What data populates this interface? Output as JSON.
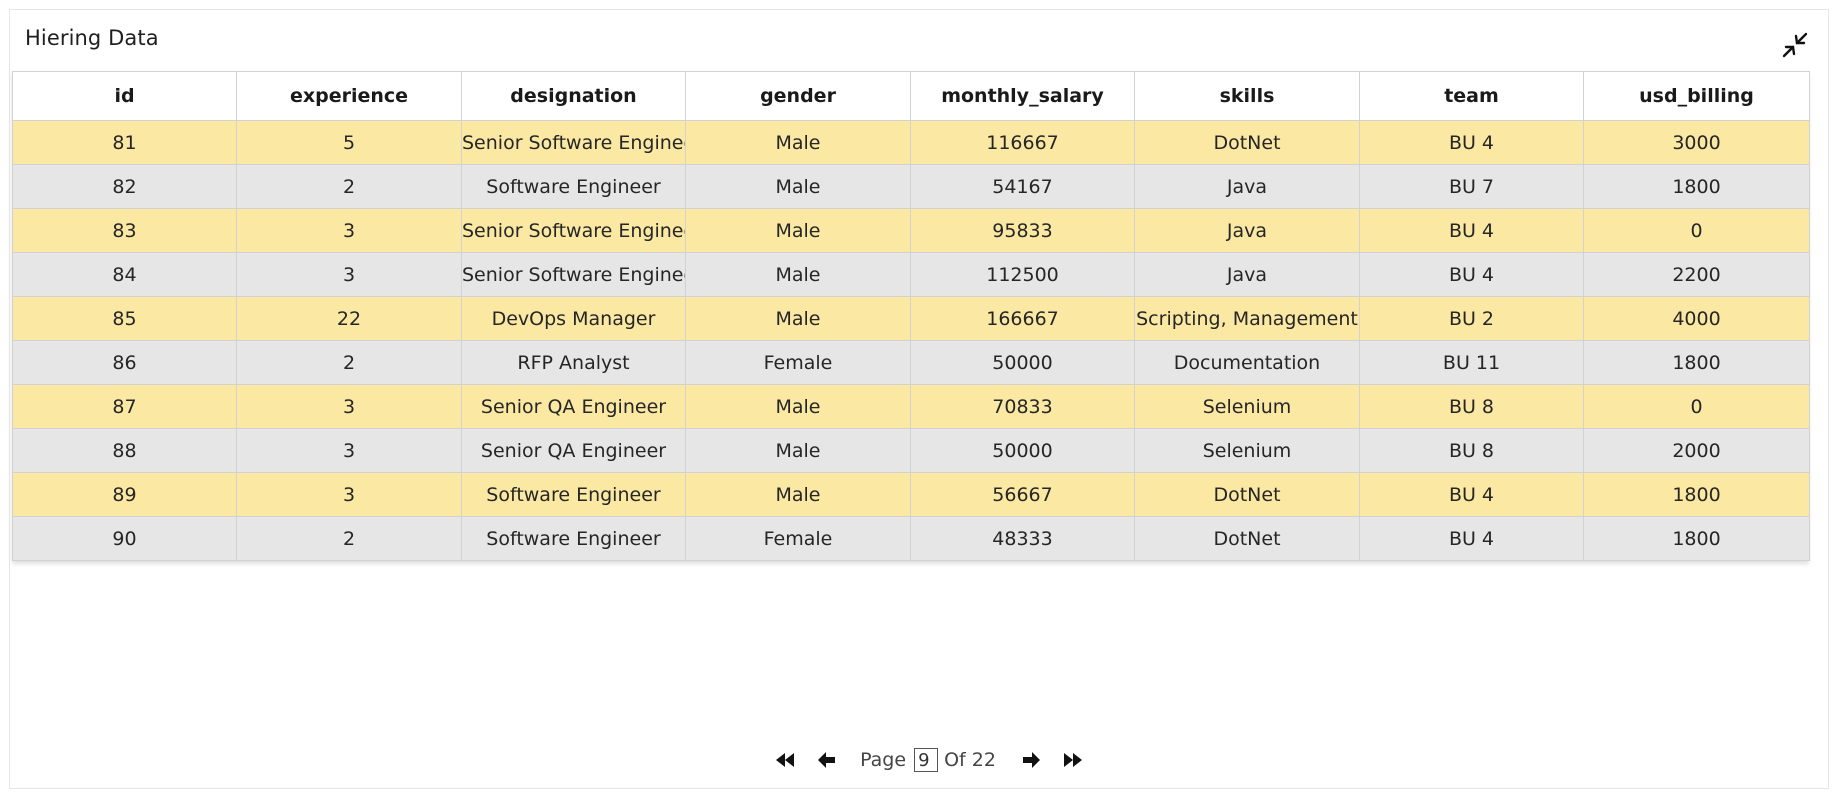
{
  "panel": {
    "title": "Hiering Data",
    "collapse_icon": "collapse-arrows-icon"
  },
  "table": {
    "columns": [
      "id",
      "experience",
      "designation",
      "gender",
      "monthly_salary",
      "skills",
      "team",
      "usd_billing"
    ],
    "rows": [
      [
        "81",
        "5",
        "Senior Software Engineer",
        "Male",
        "116667",
        "DotNet",
        "BU 4",
        "3000"
      ],
      [
        "82",
        "2",
        "Software Engineer",
        "Male",
        "54167",
        "Java",
        "BU 7",
        "1800"
      ],
      [
        "83",
        "3",
        "Senior Software Engineer",
        "Male",
        "95833",
        "Java",
        "BU 4",
        "0"
      ],
      [
        "84",
        "3",
        "Senior Software Engineer",
        "Male",
        "112500",
        "Java",
        "BU 4",
        "2200"
      ],
      [
        "85",
        "22",
        "DevOps Manager",
        "Male",
        "166667",
        "Scripting, Management",
        "BU 2",
        "4000"
      ],
      [
        "86",
        "2",
        "RFP Analyst",
        "Female",
        "50000",
        "Documentation",
        "BU 11",
        "1800"
      ],
      [
        "87",
        "3",
        "Senior QA Engineer",
        "Male",
        "70833",
        "Selenium",
        "BU 8",
        "0"
      ],
      [
        "88",
        "3",
        "Senior QA Engineer",
        "Male",
        "50000",
        "Selenium",
        "BU 8",
        "2000"
      ],
      [
        "89",
        "3",
        "Software Engineer",
        "Male",
        "56667",
        "DotNet",
        "BU 4",
        "1800"
      ],
      [
        "90",
        "2",
        "Software Engineer",
        "Female",
        "48333",
        "DotNet",
        "BU 4",
        "1800"
      ]
    ],
    "row_colors": {
      "odd": "#fbe9a3",
      "even": "#e6e6e6"
    }
  },
  "pagination": {
    "page_label": "Page",
    "current_page": "9",
    "of_label": "Of 22",
    "icons": [
      "first-page-icon",
      "previous-page-icon",
      "next-page-icon",
      "last-page-icon"
    ]
  }
}
